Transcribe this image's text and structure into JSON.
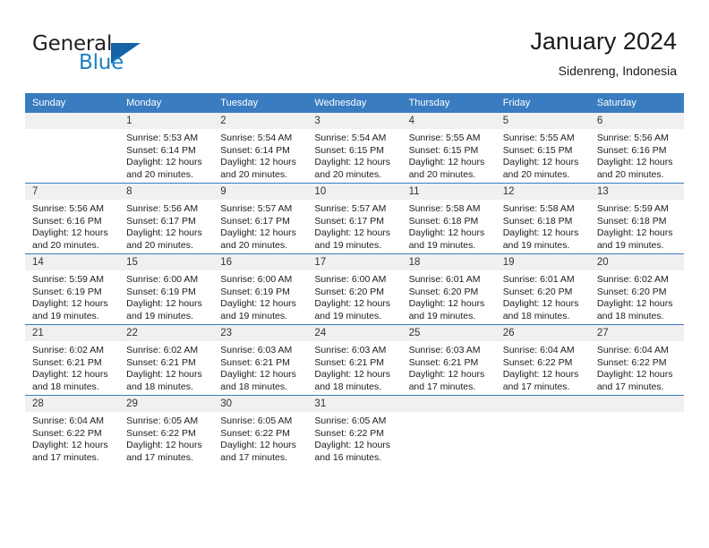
{
  "logo": {
    "word_one": "General",
    "word_two": "Blue",
    "triangle_color": "#1763a8",
    "blue_color": "#1b7fc4"
  },
  "header": {
    "title": "January 2024",
    "subtitle": "Sidenreng, Indonesia"
  },
  "theme": {
    "header_bg": "#3a7cc0",
    "daynum_bg": "#f0f0f0",
    "rule_color": "#3a7cc0"
  },
  "weekdays": [
    "Sunday",
    "Monday",
    "Tuesday",
    "Wednesday",
    "Thursday",
    "Friday",
    "Saturday"
  ],
  "weeks": [
    [
      {
        "day": "",
        "empty": true,
        "sunrise": "",
        "sunset": "",
        "daylight_a": "",
        "daylight_b": ""
      },
      {
        "day": "1",
        "empty": false,
        "sunrise": "Sunrise: 5:53 AM",
        "sunset": "Sunset: 6:14 PM",
        "daylight_a": "Daylight: 12 hours",
        "daylight_b": "and 20 minutes."
      },
      {
        "day": "2",
        "empty": false,
        "sunrise": "Sunrise: 5:54 AM",
        "sunset": "Sunset: 6:14 PM",
        "daylight_a": "Daylight: 12 hours",
        "daylight_b": "and 20 minutes."
      },
      {
        "day": "3",
        "empty": false,
        "sunrise": "Sunrise: 5:54 AM",
        "sunset": "Sunset: 6:15 PM",
        "daylight_a": "Daylight: 12 hours",
        "daylight_b": "and 20 minutes."
      },
      {
        "day": "4",
        "empty": false,
        "sunrise": "Sunrise: 5:55 AM",
        "sunset": "Sunset: 6:15 PM",
        "daylight_a": "Daylight: 12 hours",
        "daylight_b": "and 20 minutes."
      },
      {
        "day": "5",
        "empty": false,
        "sunrise": "Sunrise: 5:55 AM",
        "sunset": "Sunset: 6:15 PM",
        "daylight_a": "Daylight: 12 hours",
        "daylight_b": "and 20 minutes."
      },
      {
        "day": "6",
        "empty": false,
        "sunrise": "Sunrise: 5:56 AM",
        "sunset": "Sunset: 6:16 PM",
        "daylight_a": "Daylight: 12 hours",
        "daylight_b": "and 20 minutes."
      }
    ],
    [
      {
        "day": "7",
        "empty": false,
        "sunrise": "Sunrise: 5:56 AM",
        "sunset": "Sunset: 6:16 PM",
        "daylight_a": "Daylight: 12 hours",
        "daylight_b": "and 20 minutes."
      },
      {
        "day": "8",
        "empty": false,
        "sunrise": "Sunrise: 5:56 AM",
        "sunset": "Sunset: 6:17 PM",
        "daylight_a": "Daylight: 12 hours",
        "daylight_b": "and 20 minutes."
      },
      {
        "day": "9",
        "empty": false,
        "sunrise": "Sunrise: 5:57 AM",
        "sunset": "Sunset: 6:17 PM",
        "daylight_a": "Daylight: 12 hours",
        "daylight_b": "and 20 minutes."
      },
      {
        "day": "10",
        "empty": false,
        "sunrise": "Sunrise: 5:57 AM",
        "sunset": "Sunset: 6:17 PM",
        "daylight_a": "Daylight: 12 hours",
        "daylight_b": "and 19 minutes."
      },
      {
        "day": "11",
        "empty": false,
        "sunrise": "Sunrise: 5:58 AM",
        "sunset": "Sunset: 6:18 PM",
        "daylight_a": "Daylight: 12 hours",
        "daylight_b": "and 19 minutes."
      },
      {
        "day": "12",
        "empty": false,
        "sunrise": "Sunrise: 5:58 AM",
        "sunset": "Sunset: 6:18 PM",
        "daylight_a": "Daylight: 12 hours",
        "daylight_b": "and 19 minutes."
      },
      {
        "day": "13",
        "empty": false,
        "sunrise": "Sunrise: 5:59 AM",
        "sunset": "Sunset: 6:18 PM",
        "daylight_a": "Daylight: 12 hours",
        "daylight_b": "and 19 minutes."
      }
    ],
    [
      {
        "day": "14",
        "empty": false,
        "sunrise": "Sunrise: 5:59 AM",
        "sunset": "Sunset: 6:19 PM",
        "daylight_a": "Daylight: 12 hours",
        "daylight_b": "and 19 minutes."
      },
      {
        "day": "15",
        "empty": false,
        "sunrise": "Sunrise: 6:00 AM",
        "sunset": "Sunset: 6:19 PM",
        "daylight_a": "Daylight: 12 hours",
        "daylight_b": "and 19 minutes."
      },
      {
        "day": "16",
        "empty": false,
        "sunrise": "Sunrise: 6:00 AM",
        "sunset": "Sunset: 6:19 PM",
        "daylight_a": "Daylight: 12 hours",
        "daylight_b": "and 19 minutes."
      },
      {
        "day": "17",
        "empty": false,
        "sunrise": "Sunrise: 6:00 AM",
        "sunset": "Sunset: 6:20 PM",
        "daylight_a": "Daylight: 12 hours",
        "daylight_b": "and 19 minutes."
      },
      {
        "day": "18",
        "empty": false,
        "sunrise": "Sunrise: 6:01 AM",
        "sunset": "Sunset: 6:20 PM",
        "daylight_a": "Daylight: 12 hours",
        "daylight_b": "and 19 minutes."
      },
      {
        "day": "19",
        "empty": false,
        "sunrise": "Sunrise: 6:01 AM",
        "sunset": "Sunset: 6:20 PM",
        "daylight_a": "Daylight: 12 hours",
        "daylight_b": "and 18 minutes."
      },
      {
        "day": "20",
        "empty": false,
        "sunrise": "Sunrise: 6:02 AM",
        "sunset": "Sunset: 6:20 PM",
        "daylight_a": "Daylight: 12 hours",
        "daylight_b": "and 18 minutes."
      }
    ],
    [
      {
        "day": "21",
        "empty": false,
        "sunrise": "Sunrise: 6:02 AM",
        "sunset": "Sunset: 6:21 PM",
        "daylight_a": "Daylight: 12 hours",
        "daylight_b": "and 18 minutes."
      },
      {
        "day": "22",
        "empty": false,
        "sunrise": "Sunrise: 6:02 AM",
        "sunset": "Sunset: 6:21 PM",
        "daylight_a": "Daylight: 12 hours",
        "daylight_b": "and 18 minutes."
      },
      {
        "day": "23",
        "empty": false,
        "sunrise": "Sunrise: 6:03 AM",
        "sunset": "Sunset: 6:21 PM",
        "daylight_a": "Daylight: 12 hours",
        "daylight_b": "and 18 minutes."
      },
      {
        "day": "24",
        "empty": false,
        "sunrise": "Sunrise: 6:03 AM",
        "sunset": "Sunset: 6:21 PM",
        "daylight_a": "Daylight: 12 hours",
        "daylight_b": "and 18 minutes."
      },
      {
        "day": "25",
        "empty": false,
        "sunrise": "Sunrise: 6:03 AM",
        "sunset": "Sunset: 6:21 PM",
        "daylight_a": "Daylight: 12 hours",
        "daylight_b": "and 17 minutes."
      },
      {
        "day": "26",
        "empty": false,
        "sunrise": "Sunrise: 6:04 AM",
        "sunset": "Sunset: 6:22 PM",
        "daylight_a": "Daylight: 12 hours",
        "daylight_b": "and 17 minutes."
      },
      {
        "day": "27",
        "empty": false,
        "sunrise": "Sunrise: 6:04 AM",
        "sunset": "Sunset: 6:22 PM",
        "daylight_a": "Daylight: 12 hours",
        "daylight_b": "and 17 minutes."
      }
    ],
    [
      {
        "day": "28",
        "empty": false,
        "sunrise": "Sunrise: 6:04 AM",
        "sunset": "Sunset: 6:22 PM",
        "daylight_a": "Daylight: 12 hours",
        "daylight_b": "and 17 minutes."
      },
      {
        "day": "29",
        "empty": false,
        "sunrise": "Sunrise: 6:05 AM",
        "sunset": "Sunset: 6:22 PM",
        "daylight_a": "Daylight: 12 hours",
        "daylight_b": "and 17 minutes."
      },
      {
        "day": "30",
        "empty": false,
        "sunrise": "Sunrise: 6:05 AM",
        "sunset": "Sunset: 6:22 PM",
        "daylight_a": "Daylight: 12 hours",
        "daylight_b": "and 17 minutes."
      },
      {
        "day": "31",
        "empty": false,
        "sunrise": "Sunrise: 6:05 AM",
        "sunset": "Sunset: 6:22 PM",
        "daylight_a": "Daylight: 12 hours",
        "daylight_b": "and 16 minutes."
      },
      {
        "day": "",
        "empty": true,
        "sunrise": "",
        "sunset": "",
        "daylight_a": "",
        "daylight_b": ""
      },
      {
        "day": "",
        "empty": true,
        "sunrise": "",
        "sunset": "",
        "daylight_a": "",
        "daylight_b": ""
      },
      {
        "day": "",
        "empty": true,
        "sunrise": "",
        "sunset": "",
        "daylight_a": "",
        "daylight_b": ""
      }
    ]
  ]
}
